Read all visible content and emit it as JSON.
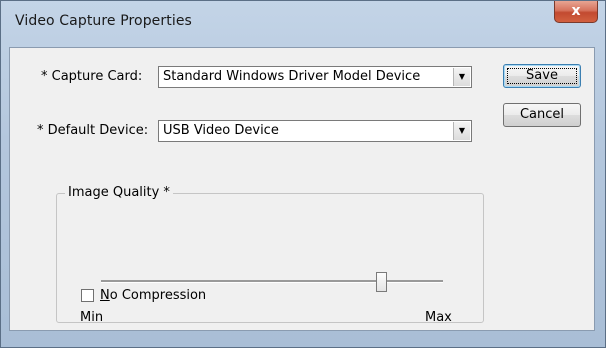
{
  "window": {
    "title": "Video Capture Properties",
    "close_symbol": "x"
  },
  "form": {
    "capture_card": {
      "label": "* Capture Card:",
      "value": "Standard Windows Driver Model Device"
    },
    "default_device": {
      "label": "* Default Device:",
      "value": "USB Video Device"
    },
    "image_quality": {
      "label": "Image Quality *",
      "min_label": "Min",
      "max_label": "Max",
      "level_fraction": 0.82
    },
    "no_compression": {
      "mnemonic": "N",
      "rest": "o Compression",
      "checked": false
    }
  },
  "buttons": {
    "save": "Save",
    "cancel": "Cancel"
  },
  "icons": {
    "combo_arrow": "▼"
  }
}
